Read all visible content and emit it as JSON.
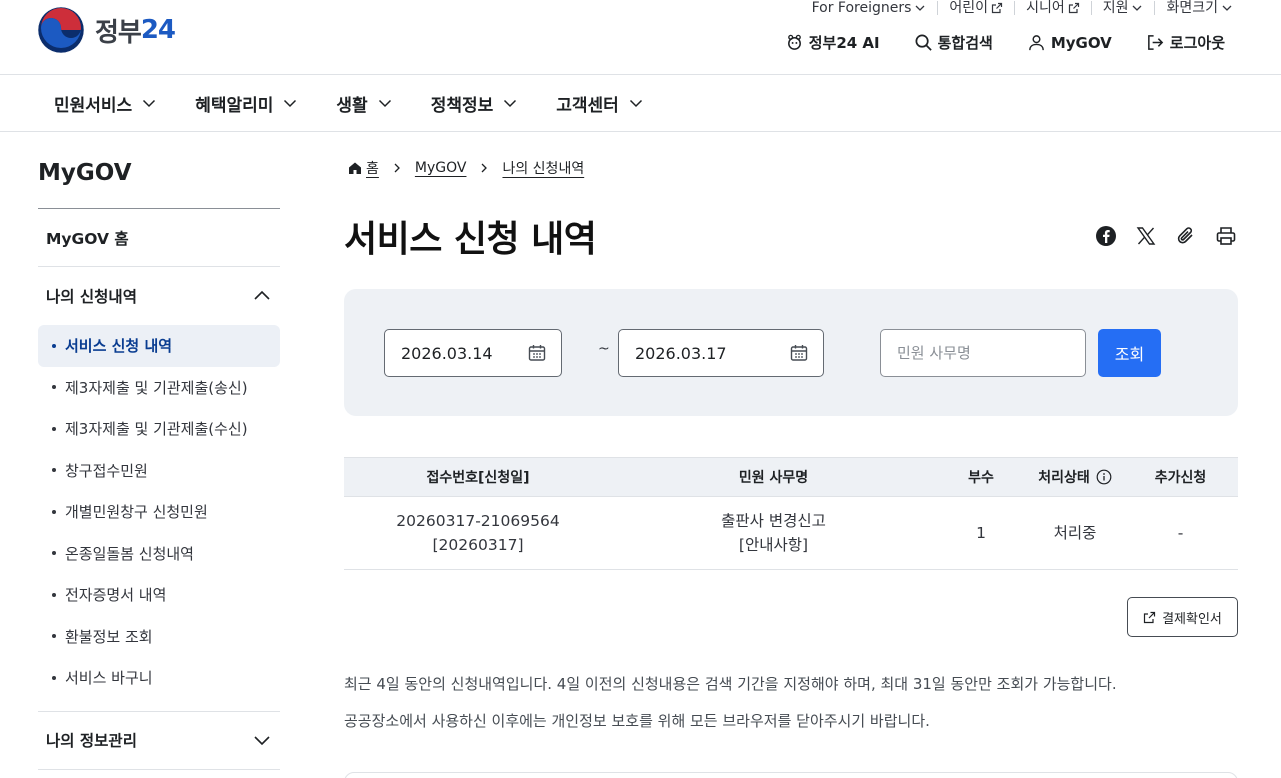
{
  "header": {
    "logo_text": "정부",
    "logo_number": "24",
    "utility": [
      {
        "label": "For Foreigners",
        "icon": "chevron-down-icon"
      },
      {
        "label": "어린이",
        "icon": "external-link-icon"
      },
      {
        "label": "시니어",
        "icon": "external-link-icon"
      },
      {
        "label": "지원",
        "icon": "chevron-down-icon"
      },
      {
        "label": "화면크기",
        "icon": "chevron-down-icon"
      }
    ],
    "actions": [
      {
        "label": "정부24 AI",
        "icon": "ai-icon"
      },
      {
        "label": "통합검색",
        "icon": "search-icon"
      },
      {
        "label": "MyGOV",
        "icon": "user-icon"
      },
      {
        "label": "로그아웃",
        "icon": "logout-icon"
      }
    ]
  },
  "gnb": [
    {
      "label": "민원서비스"
    },
    {
      "label": "혜택알리미"
    },
    {
      "label": "생활"
    },
    {
      "label": "정책정보"
    },
    {
      "label": "고객센터"
    }
  ],
  "sidebar": {
    "title": "MyGOV",
    "home": "MyGOV 홈",
    "section1": "나의 신청내역",
    "items": [
      "서비스 신청 내역",
      "제3자제출 및 기관제출(송신)",
      "제3자제출 및 기관제출(수신)",
      "창구접수민원",
      "개별민원창구 신청민원",
      "온종일돌봄 신청내역",
      "전자증명서 내역",
      "환불정보 조회",
      "서비스 바구니"
    ],
    "section2": "나의 정보관리"
  },
  "breadcrumb": [
    "홈",
    "MyGOV",
    "나의 신청내역"
  ],
  "page": {
    "title": "서비스 신청 내역"
  },
  "search": {
    "start_date": "2026.03.14",
    "end_date": "2026.03.17",
    "separator": "~",
    "name_placeholder": "민원 사무명",
    "submit_label": "조회"
  },
  "table": {
    "headers": [
      "접수번호[신청일]",
      "민원 사무명",
      "부수",
      "처리상태",
      "추가신청"
    ],
    "rows": [
      {
        "receipt_no": "20260317-21069564",
        "apply_date": "[20260317]",
        "name": "출판사 변경신고",
        "name_note": "[안내사항]",
        "copies": "1",
        "status": "처리중",
        "extra": "-"
      }
    ]
  },
  "payment_button": "결제확인서",
  "notices": [
    "최근 4일 동안의 신청내역입니다. 4일 이전의 신청내용은 검색 기간을 지정해야 하며, 최대 31일 동안만 조회가 가능합니다.",
    "공공장소에서 사용하신 이후에는 개인정보 보호를 위해 모든 브라우저를 닫아주시기 바랍니다."
  ],
  "colors": {
    "primary": "#256ef4",
    "active_text": "#0a3d91",
    "active_bg": "#ecf0f6",
    "panel_bg": "#eef1f5"
  }
}
